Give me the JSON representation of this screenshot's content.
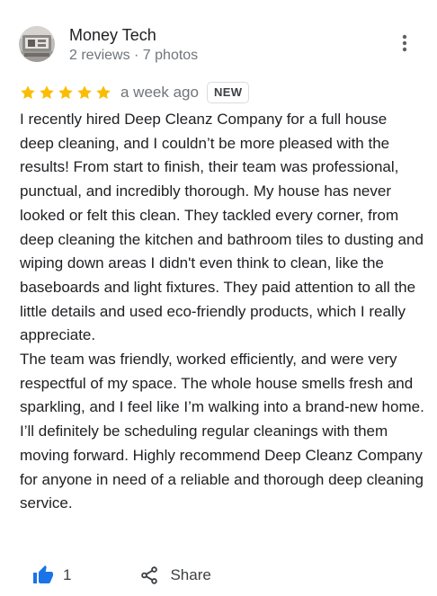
{
  "reviewer": {
    "name": "Money Tech",
    "meta": "2 reviews · 7 photos"
  },
  "review": {
    "rating": 5,
    "rating_max": 5,
    "time": "a week ago",
    "badge": "NEW",
    "paragraphs": [
      "I recently hired Deep Cleanz Company for a full house deep cleaning, and I couldn’t be more pleased with the results! From start to finish, their team was professional, punctual, and incredibly thorough. My house has never looked or felt this clean. They tackled every corner, from deep cleaning the kitchen and bathroom tiles to dusting and wiping down areas I didn't even think to clean, like the baseboards and light fixtures. They paid attention to all the little details and used eco-friendly products, which I really appreciate.",
      "The team was friendly, worked efficiently, and were very respectful of my space. The whole house smells fresh and sparkling, and I feel like I’m walking into a brand-new home. I’ll definitely be scheduling regular cleanings with them moving forward. Highly recommend Deep Cleanz Company for anyone in need of a reliable and thorough deep cleaning service."
    ]
  },
  "actions": {
    "like_count": "1",
    "share_label": "Share"
  },
  "colors": {
    "star": "#fbbc04",
    "like_icon": "#1a73e8",
    "secondary_text": "#70757a"
  },
  "icons": {
    "more": "more-vertical-icon",
    "like": "thumbs-up-icon",
    "share": "share-icon"
  }
}
